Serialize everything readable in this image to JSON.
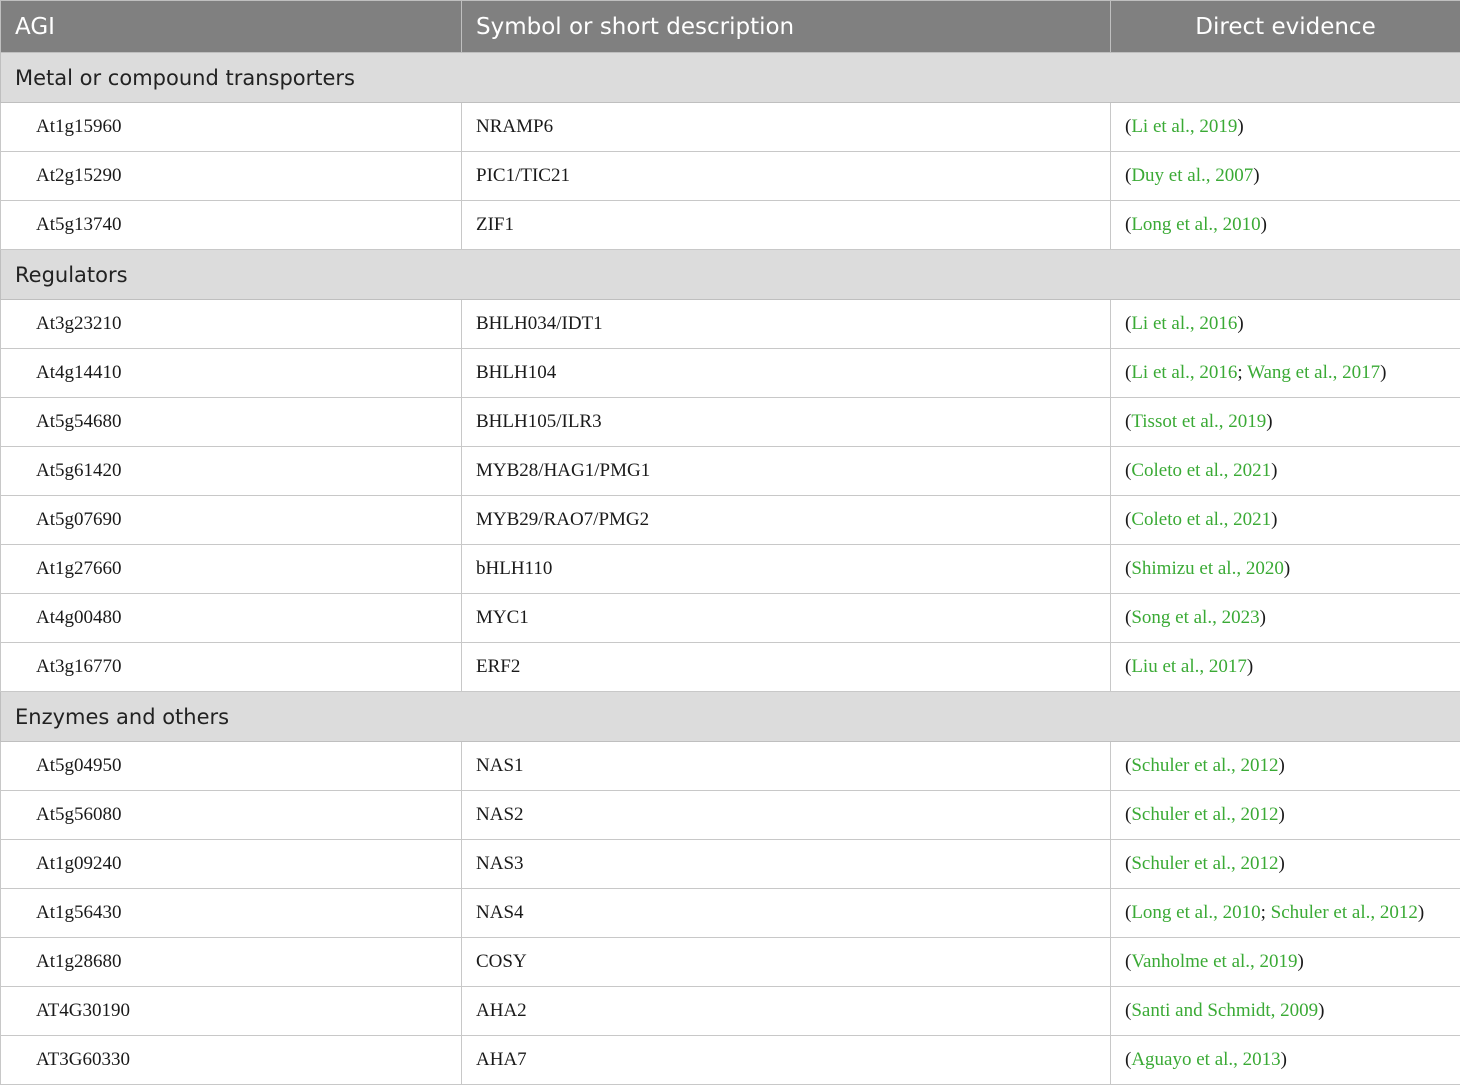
{
  "headers": [
    "AGI",
    "Symbol or short description",
    "Direct evidence"
  ],
  "sections": [
    {
      "title": "Metal or compound transporters",
      "rows": [
        {
          "agi": "At1g15960",
          "symbol": "NRAMP6",
          "refs": [
            "Li et al., 2019"
          ]
        },
        {
          "agi": "At2g15290",
          "symbol": "PIC1/TIC21",
          "refs": [
            "Duy et al., 2007"
          ]
        },
        {
          "agi": "At5g13740",
          "symbol": "ZIF1",
          "refs": [
            "Long et al., 2010"
          ]
        }
      ]
    },
    {
      "title": "Regulators",
      "rows": [
        {
          "agi": "At3g23210",
          "symbol": "BHLH034/IDT1",
          "refs": [
            "Li et al., 2016"
          ]
        },
        {
          "agi": "At4g14410",
          "symbol": "BHLH104",
          "refs": [
            "Li et al., 2016",
            "Wang et al., 2017"
          ]
        },
        {
          "agi": "At5g54680",
          "symbol": "BHLH105/ILR3",
          "refs": [
            "Tissot et al., 2019"
          ]
        },
        {
          "agi": "At5g61420",
          "symbol": "MYB28/HAG1/PMG1",
          "refs": [
            "Coleto et al., 2021"
          ]
        },
        {
          "agi": "At5g07690",
          "symbol": "MYB29/RAO7/PMG2",
          "refs": [
            "Coleto et al., 2021"
          ]
        },
        {
          "agi": "At1g27660",
          "symbol": "bHLH110",
          "refs": [
            "Shimizu et al., 2020"
          ]
        },
        {
          "agi": "At4g00480",
          "symbol": "MYC1",
          "refs": [
            "Song et al., 2023"
          ]
        },
        {
          "agi": "At3g16770",
          "symbol": "ERF2",
          "refs": [
            "Liu et al., 2017"
          ]
        }
      ]
    },
    {
      "title": "Enzymes and others",
      "rows": [
        {
          "agi": "At5g04950",
          "symbol": "NAS1",
          "refs": [
            "Schuler et al., 2012"
          ]
        },
        {
          "agi": "At5g56080",
          "symbol": "NAS2",
          "refs": [
            "Schuler et al., 2012"
          ]
        },
        {
          "agi": "At1g09240",
          "symbol": "NAS3",
          "refs": [
            "Schuler et al., 2012"
          ]
        },
        {
          "agi": "At1g56430",
          "symbol": "NAS4",
          "refs": [
            "Long et al., 2010",
            "Schuler et al., 2012"
          ]
        },
        {
          "agi": "At1g28680",
          "symbol": "COSY",
          "refs": [
            "Vanholme et al., 2019"
          ]
        },
        {
          "agi": "AT4G30190",
          "symbol": "AHA2",
          "refs": [
            "Santi and Schmidt, 2009"
          ]
        },
        {
          "agi": "AT3G60330",
          "symbol": "AHA7",
          "refs": [
            "Aguayo et al., 2013"
          ]
        }
      ]
    }
  ],
  "punctuation": {
    "open": "(",
    "close": ")",
    "separator": "; "
  },
  "colors": {
    "header_bg": "#808080",
    "section_bg": "#dcdcdc",
    "link": "#3aaa35"
  }
}
